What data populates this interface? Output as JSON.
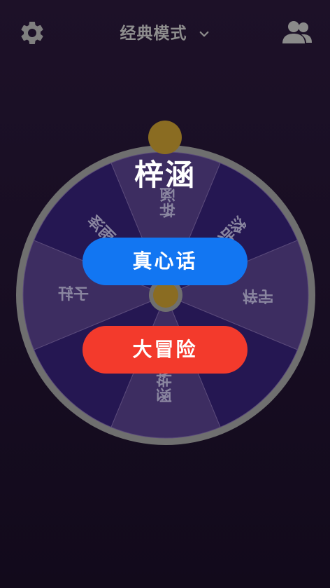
{
  "header": {
    "mode_label": "经典模式"
  },
  "icons": {
    "settings": "gear-icon",
    "dropdown": "chevron-down-icon",
    "players": "users-icon"
  },
  "wheel": {
    "segments": [
      "梓涵",
      "浩然",
      "梓宇",
      "浩",
      "梓涵",
      "梓",
      "子轩",
      "雨泽"
    ]
  },
  "result": {
    "name": "梓涵"
  },
  "buttons": {
    "truth": "真心话",
    "dare": "大冒险"
  },
  "colors": {
    "background": "#1a0f25",
    "wheel_rim": "#6f6f6f",
    "segment_light": "#3d2d61",
    "segment_dark": "#251752",
    "pointer": "#8a6c22",
    "truth_button": "#1276f2",
    "dare_button": "#f33a2c",
    "header_text": "#8e8e8e"
  }
}
